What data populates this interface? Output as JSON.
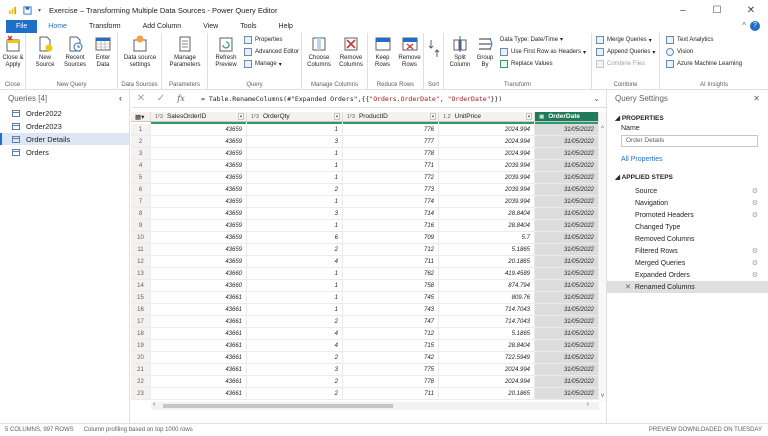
{
  "window": {
    "title": "Exercise – Transforming Multiple Data Sources - Power Query Editor"
  },
  "menu": [
    "File",
    "Home",
    "Transform",
    "Add Column",
    "View",
    "Tools",
    "Help"
  ],
  "ribbon": {
    "close_apply": "Close & Apply",
    "new_source": "New Source",
    "recent_sources": "Recent Sources",
    "enter_data": "Enter Data",
    "data_source_settings": "Data source settings",
    "manage_parameters": "Manage Parameters",
    "refresh_preview": "Refresh Preview",
    "properties": "Properties",
    "advanced_editor": "Advanced Editor",
    "manage": "Manage",
    "choose_columns": "Choose Columns",
    "remove_columns": "Remove Columns",
    "keep_rows": "Keep Rows",
    "remove_rows": "Remove Rows",
    "split_column": "Split Column",
    "group_by": "Group By",
    "data_type": "Data Type: Date/Time",
    "first_row_headers": "Use First Row as Headers",
    "replace_values": "Replace Values",
    "merge_queries": "Merge Queries",
    "append_queries": "Append Queries",
    "combine_files": "Combine Files",
    "text_analytics": "Text Analytics",
    "vision": "Vision",
    "azure_ml": "Azure Machine Learning",
    "groups": {
      "close": "Close",
      "new_query": "New Query",
      "data_sources": "Data Sources",
      "parameters": "Parameters",
      "query": "Query",
      "manage_columns": "Manage Columns",
      "reduce_rows": "Reduce Rows",
      "sort": "Sort",
      "transform": "Transform",
      "combine": "Combine",
      "ai_insights": "AI Insights"
    }
  },
  "queries": {
    "header": "Queries [4]",
    "items": [
      "Order2022",
      "Order2023",
      "Order Details",
      "Orders"
    ],
    "selected": 2
  },
  "formula": {
    "prefix": "= Table.RenameColumns(#\"Expanded Orders\",{{",
    "str1": "\"Orders.OrderDate\"",
    "sep": ", ",
    "str2": "\"OrderDate\"",
    "suffix": "}})"
  },
  "grid": {
    "columns": [
      {
        "type": "1²3",
        "name": "SalesOrderID"
      },
      {
        "type": "1²3",
        "name": "OrderQty"
      },
      {
        "type": "1²3",
        "name": "ProductID"
      },
      {
        "type": "1.2",
        "name": "UnitPrice"
      },
      {
        "type": "▦",
        "name": "OrderDate"
      }
    ],
    "rows": [
      [
        "1",
        "43659",
        "1",
        "776",
        "2024.994",
        "31/05/2022"
      ],
      [
        "2",
        "43659",
        "3",
        "777",
        "2024.994",
        "31/05/2022"
      ],
      [
        "3",
        "43659",
        "1",
        "778",
        "2024.994",
        "31/05/2022"
      ],
      [
        "4",
        "43659",
        "1",
        "771",
        "2039.994",
        "31/05/2022"
      ],
      [
        "5",
        "43659",
        "1",
        "772",
        "2039.994",
        "31/05/2022"
      ],
      [
        "6",
        "43659",
        "2",
        "773",
        "2039.994",
        "31/05/2022"
      ],
      [
        "7",
        "43659",
        "1",
        "774",
        "2039.994",
        "31/05/2022"
      ],
      [
        "8",
        "43659",
        "3",
        "714",
        "28.8404",
        "31/05/2022"
      ],
      [
        "9",
        "43659",
        "1",
        "716",
        "28.8404",
        "31/05/2022"
      ],
      [
        "10",
        "43659",
        "6",
        "709",
        "5.7",
        "31/05/2022"
      ],
      [
        "11",
        "43659",
        "2",
        "712",
        "5.1865",
        "31/05/2022"
      ],
      [
        "12",
        "43659",
        "4",
        "711",
        "20.1865",
        "31/05/2022"
      ],
      [
        "13",
        "43660",
        "1",
        "762",
        "419.4589",
        "31/05/2022"
      ],
      [
        "14",
        "43660",
        "1",
        "758",
        "874.794",
        "31/05/2022"
      ],
      [
        "15",
        "43661",
        "1",
        "745",
        "809.76",
        "31/05/2022"
      ],
      [
        "16",
        "43661",
        "1",
        "743",
        "714.7043",
        "31/05/2022"
      ],
      [
        "17",
        "43661",
        "2",
        "747",
        "714.7043",
        "31/05/2022"
      ],
      [
        "18",
        "43661",
        "4",
        "712",
        "5.1865",
        "31/05/2022"
      ],
      [
        "19",
        "43661",
        "4",
        "715",
        "28.8404",
        "31/05/2022"
      ],
      [
        "20",
        "43661",
        "2",
        "742",
        "722.5949",
        "31/05/2022"
      ],
      [
        "21",
        "43661",
        "3",
        "775",
        "2024.994",
        "31/05/2022"
      ],
      [
        "22",
        "43661",
        "2",
        "778",
        "2024.994",
        "31/05/2022"
      ],
      [
        "23",
        "43661",
        "2",
        "711",
        "20.1865",
        "31/05/2022"
      ]
    ]
  },
  "settings": {
    "header": "Query Settings",
    "properties": "PROPERTIES",
    "name_label": "Name",
    "name_value": "Order Details",
    "all_properties": "All Properties",
    "applied_steps": "APPLIED STEPS",
    "steps": [
      {
        "label": "Source",
        "gear": true
      },
      {
        "label": "Navigation",
        "gear": true
      },
      {
        "label": "Promoted Headers",
        "gear": true
      },
      {
        "label": "Changed Type",
        "gear": false
      },
      {
        "label": "Removed Columns",
        "gear": false
      },
      {
        "label": "Filtered Rows",
        "gear": true
      },
      {
        "label": "Merged Queries",
        "gear": true
      },
      {
        "label": "Expanded Orders",
        "gear": true
      },
      {
        "label": "Renamed Columns",
        "gear": false
      }
    ],
    "active_step": 8
  },
  "status": {
    "left": "5 COLUMNS, 997 ROWS",
    "profiling": "Column profiling based on top 1000 rows",
    "right": "PREVIEW DOWNLOADED ON TUESDAY"
  },
  "colors": {
    "accent": "#1f6fc8",
    "selected_column": "#1e7a5a",
    "quality": "#2e9a68"
  }
}
